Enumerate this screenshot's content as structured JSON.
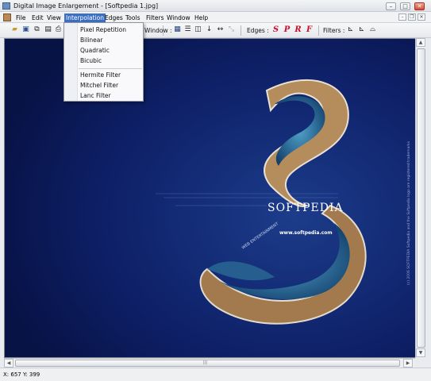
{
  "window": {
    "title": "Digital Image Enlargement - [Softpedia 1.jpg]",
    "controls": {
      "minimize": "–",
      "maximize": "□",
      "close": "✕"
    }
  },
  "menu": {
    "items": [
      "File",
      "Edit",
      "View",
      "Interpolation",
      "Edges",
      "Tools",
      "Filters",
      "Window",
      "Help"
    ],
    "active": "Interpolation"
  },
  "toolbar": {
    "window_label": "Window :",
    "edges_label": "Edges :",
    "edge_buttons": [
      "S",
      "P",
      "R",
      "F"
    ],
    "filters_label": "Filters :",
    "icons": [
      "open-icon",
      "save-icon",
      "copy-icon",
      "paste-icon",
      "print-icon"
    ]
  },
  "interpolation_menu": {
    "items": [
      "Pixel Repetition",
      "Bilinear",
      "Quadratic",
      "Bicubic",
      "Hermite Filter",
      "Mitchel Filter",
      "Lanc Filter"
    ]
  },
  "canvas": {
    "brand_text": "SOFTPEDIA",
    "url_text": "www.softpedia.com",
    "web_text": "WEB ENTERTAINMENT",
    "side_text": "(c) 2006 SOFTPEDIA  Softpedia and the Softpedia logo are registered trademarks",
    "colors": {
      "sea": "#0c1a55",
      "shore": "#a07a52",
      "lagoon": "#1f5a8a"
    }
  },
  "status": {
    "coords": "X: 657  Y: 399"
  }
}
